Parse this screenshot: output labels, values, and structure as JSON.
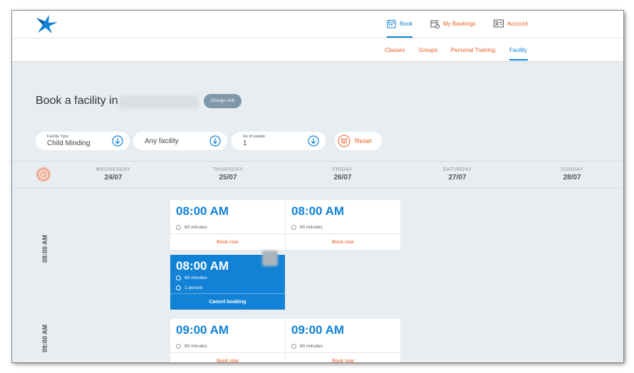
{
  "nav": {
    "book": "Book",
    "my_bookings": "My Bookings",
    "account": "Account"
  },
  "subnav": {
    "classes": "Classes",
    "groups": "Groups",
    "personal_training": "Personal Training",
    "facility": "Facility"
  },
  "page": {
    "heading": "Book a facility in",
    "change_club": "Change club"
  },
  "filters": {
    "facility_type_label": "Facility Type",
    "facility_type_value": "Child Minding",
    "facility_value": "Any facility",
    "people_label": "No of people",
    "people_value": "1",
    "reset": "Reset"
  },
  "days": [
    {
      "name": "WEDNESDAY",
      "date": "24/07"
    },
    {
      "name": "THURSDAY",
      "date": "25/07"
    },
    {
      "name": "FRIDAY",
      "date": "26/07"
    },
    {
      "name": "SATURDAY",
      "date": "27/07"
    },
    {
      "name": "SUNDAY",
      "date": "28/07"
    }
  ],
  "time_labels": [
    "08:00 AM",
    "09:00 AM"
  ],
  "slots": [
    {
      "time": "08:00 AM",
      "duration": "60 minutes",
      "action": "Book now"
    },
    {
      "time": "08:00 AM",
      "duration": "60 minutes",
      "action": "Book now"
    },
    {
      "time": "08:00 AM",
      "duration": "60 minutes",
      "people": "1 person",
      "action": "Cancel booking"
    },
    {
      "time": "09:00 AM",
      "duration": "60 minutes",
      "action": "Book now"
    },
    {
      "time": "09:00 AM",
      "duration": "60 minutes",
      "action": "Book now"
    }
  ],
  "colors": {
    "primary_blue": "#1182d6",
    "accent_orange": "#e85d24",
    "background": "#e7edf1"
  }
}
